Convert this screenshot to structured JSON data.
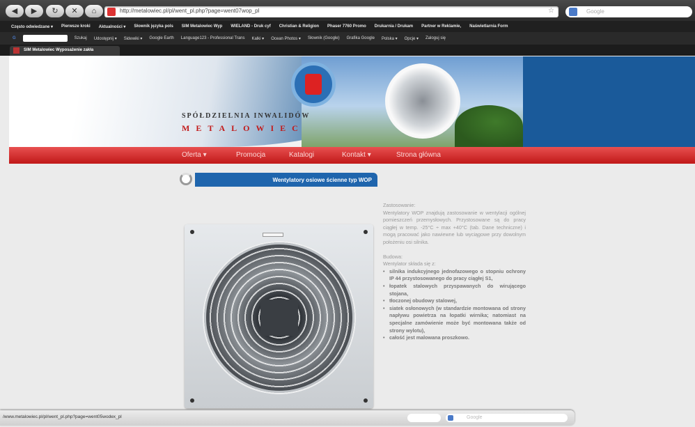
{
  "browser": {
    "url": "http://metalowiec.pl/pl/went_pl.php?page=went07wop_pl",
    "search_placeholder": "Google",
    "status_url": "/www.metalowiec.pl/pl/went_pl.php?page=went05wodex_pl",
    "status_search_placeholder": "Google",
    "tab_title": "SIM Metalowiec Wyposażenie zakła"
  },
  "bookmarks_bar": [
    "Często odwiedzane ▾",
    "Pierwsze kroki",
    "Aktualności ▾",
    "Słownik języka pols",
    "SIM Metalowiec Wyp",
    "WIELAND - Druk cyf",
    "Christian & Religion",
    "Phaser 7760 Promo",
    "Drukarnia / Drukam",
    "Partner w Reklamie,",
    "Naświetlarnia Form"
  ],
  "toolbar_items": [
    "Szukaj",
    "Udostępnij ▾",
    "Sidewiki ▾",
    "Google Earth",
    "Language123 - Professional Trans",
    "Kalki ▾",
    "Ocean Photos ▾",
    "Słownik (Google)",
    "Grafika Google",
    "Polska ▾",
    "Opcje ▾",
    "Zaloguj się"
  ],
  "site": {
    "org_line1": "SPÓŁDZIELNIA INWALIDÓW",
    "org_line2": "METALOWIEC"
  },
  "menu": [
    "Oferta ▾",
    "Promocja",
    "Katalogi",
    "Kontakt ▾",
    "Strona główna"
  ],
  "product": {
    "heading": "Wentylatory osiowe ścienne typ WOP",
    "usage_title": "Zastosowanie:",
    "usage_text": "Wentylatory WOP znajdują zastosowanie w wentylacji ogólnej pomieszczeń przemysłowych. Przystosowane są do pracy ciągłej w temp. -25°C ÷ max +40°C (tab. Dane techniczne) i mogą pracować jako nawiewne lub wyciągowe przy dowolnym położeniu osi silnika.",
    "build_title": "Budowa:",
    "build_intro": "Wentylator składa się z:",
    "parts": [
      "silnika indukcyjnego jednofazowego o stopniu ochrony IP 44 przystosowanego do pracy ciągłej S1,",
      "łopatek stalowych przyspawanych do wirującego stojana,",
      "tłoczonej obudowy stalowej,",
      "siatek osłonowych (w standardzie montowana od strony napływu powietrza na łopatki wirnika; natomiast na specjalne zamówienie może być montowana także od strony wylotu),",
      "całość jest malowana proszkowo."
    ]
  },
  "colors": {
    "menu_red": "#d22b2b",
    "heading_blue": "#1f65ad",
    "brand_red": "#c21b1b"
  }
}
